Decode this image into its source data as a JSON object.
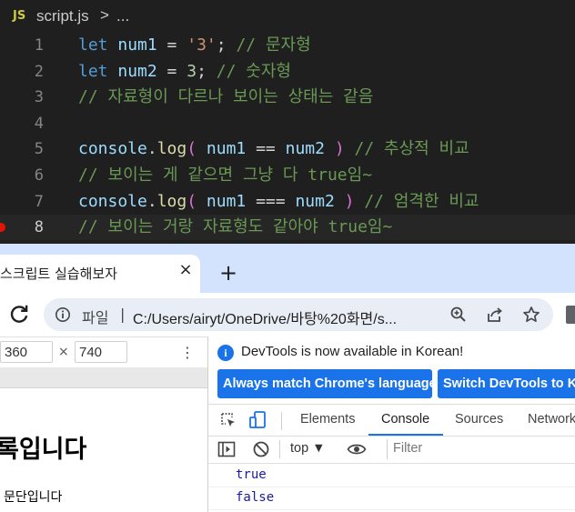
{
  "editor": {
    "file_badge": "JS",
    "file_name": "script.js",
    "breadcrumb_sep": ">",
    "breadcrumb_more": "...",
    "lines": [
      {
        "no": "1",
        "tokens": [
          {
            "t": "let",
            "c": "kw"
          },
          {
            "t": " ",
            "c": "op"
          },
          {
            "t": "num1",
            "c": "var"
          },
          {
            "t": " = ",
            "c": "op"
          },
          {
            "t": "'3'",
            "c": "str"
          },
          {
            "t": "; ",
            "c": "op"
          },
          {
            "t": "// 문자형",
            "c": "cmt"
          }
        ]
      },
      {
        "no": "2",
        "tokens": [
          {
            "t": "let",
            "c": "kw"
          },
          {
            "t": " ",
            "c": "op"
          },
          {
            "t": "num2",
            "c": "var"
          },
          {
            "t": " = ",
            "c": "op"
          },
          {
            "t": "3",
            "c": "num"
          },
          {
            "t": "; ",
            "c": "op"
          },
          {
            "t": "// 숫자형",
            "c": "cmt"
          }
        ]
      },
      {
        "no": "3",
        "tokens": [
          {
            "t": "// 자료형이 다르나 보이는 상태는 같음",
            "c": "cmt"
          }
        ]
      },
      {
        "no": "4",
        "tokens": []
      },
      {
        "no": "5",
        "tokens": [
          {
            "t": "console",
            "c": "var"
          },
          {
            "t": ".",
            "c": "op"
          },
          {
            "t": "log",
            "c": "fn"
          },
          {
            "t": "(",
            "c": "paren"
          },
          {
            "t": " num1 ",
            "c": "var"
          },
          {
            "t": "==",
            "c": "op"
          },
          {
            "t": " num2 ",
            "c": "var"
          },
          {
            "t": ")",
            "c": "paren"
          },
          {
            "t": " // 추상적 비교",
            "c": "cmt"
          }
        ]
      },
      {
        "no": "6",
        "tokens": [
          {
            "t": "// 보이는 게 같으면 그냥 다 true임~",
            "c": "cmt"
          }
        ]
      },
      {
        "no": "7",
        "tokens": [
          {
            "t": "console",
            "c": "var"
          },
          {
            "t": ".",
            "c": "op"
          },
          {
            "t": "log",
            "c": "fn"
          },
          {
            "t": "(",
            "c": "paren"
          },
          {
            "t": " num1 ",
            "c": "var"
          },
          {
            "t": "===",
            "c": "op"
          },
          {
            "t": " num2 ",
            "c": "var"
          },
          {
            "t": ")",
            "c": "paren"
          },
          {
            "t": " // 엄격한 비교",
            "c": "cmt"
          }
        ]
      },
      {
        "no": "8",
        "tokens": [
          {
            "t": "// 보이는 거랑 자료형도 같아야 true임~",
            "c": "cmt"
          }
        ]
      }
    ]
  },
  "browser": {
    "tab_title": "스크립트 실습해보자",
    "tab_close": "×",
    "new_tab": "+",
    "omnibox": {
      "scheme": "파일",
      "divider": "|",
      "url": "C:/Users/airyt/OneDrive/바탕%20화면/s..."
    },
    "device": {
      "width": "360",
      "times": "×",
      "height": "740",
      "menu": "⋮"
    },
    "page": {
      "heading": "록입니다",
      "paragraph": "문단입니다"
    }
  },
  "devtools": {
    "notice": "DevTools is now available in Korean!",
    "btn_match": "Always match Chrome's language",
    "btn_switch": "Switch DevTools to Ko",
    "tabs": [
      "Elements",
      "Console",
      "Sources",
      "Network"
    ],
    "active_tab": "Console",
    "context": "top ▼",
    "filter_placeholder": "Filter",
    "output": [
      "true",
      "false"
    ]
  },
  "colors": {
    "editor_bg": "#1f1f1f",
    "keyword": "#569cd6",
    "comment": "#6a9955",
    "accent": "#1a73e8"
  }
}
